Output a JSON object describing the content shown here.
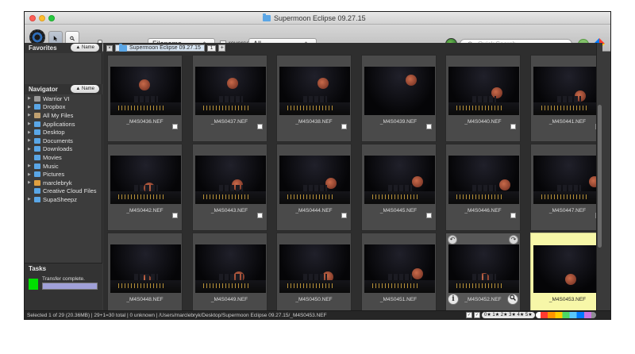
{
  "window": {
    "title": "Supermoon Eclipse 09.27.15"
  },
  "toolbar": {
    "sort_field": "Filename",
    "sort_arrows": "⌃⌄",
    "reverse_label": "reverse",
    "filter_value": "All",
    "search_placeholder": "Quick Search"
  },
  "sidebar": {
    "favorites_label": "Favorites",
    "favorites_sort": "▲ Name",
    "navigator_label": "Navigator",
    "navigator_sort": "▲ Name",
    "items": [
      {
        "label": "Warrior VI",
        "icon": "hard-drive-icon",
        "arrow": "▶"
      },
      {
        "label": "Dropbox",
        "icon": "folder-icon",
        "arrow": "▶"
      },
      {
        "label": "All My Files",
        "icon": "files-icon",
        "arrow": "▶"
      },
      {
        "label": "Applications",
        "icon": "folder-icon",
        "arrow": "▶"
      },
      {
        "label": "Desktop",
        "icon": "folder-icon",
        "arrow": "▶"
      },
      {
        "label": "Documents",
        "icon": "folder-icon",
        "arrow": "▶"
      },
      {
        "label": "Downloads",
        "icon": "folder-icon",
        "arrow": "▶"
      },
      {
        "label": "Movies",
        "icon": "folder-icon",
        "arrow": ""
      },
      {
        "label": "Music",
        "icon": "folder-icon",
        "arrow": "▶"
      },
      {
        "label": "Pictures",
        "icon": "folder-icon",
        "arrow": "▶"
      },
      {
        "label": "marclebryk",
        "icon": "home-icon",
        "arrow": "▶"
      },
      {
        "label": "Creative Cloud Files",
        "icon": "folder-icon",
        "arrow": ""
      },
      {
        "label": "SupaSheepz",
        "icon": "folder-icon",
        "arrow": "▶"
      }
    ],
    "tasks_label": "Tasks",
    "task_status": "Transfer complete."
  },
  "content": {
    "tab_label": "Supermoon Eclipse 09.27.15",
    "tab_count": "1",
    "thumbnails": [
      {
        "name": "_M4S0436.NEF"
      },
      {
        "name": "_M4S0437.NEF"
      },
      {
        "name": "_M4S0438.NEF"
      },
      {
        "name": "_M4S0439.NEF"
      },
      {
        "name": "_M4S0440.NEF"
      },
      {
        "name": "_M4S0441.NEF"
      },
      {
        "name": "_M4S0442.NEF"
      },
      {
        "name": "_M4S0443.NEF"
      },
      {
        "name": "_M4S0444.NEF"
      },
      {
        "name": "_M4S0445.NEF"
      },
      {
        "name": "_M4S0446.NEF"
      },
      {
        "name": "_M4S0447.NEF"
      },
      {
        "name": "_M4S0448.NEF"
      },
      {
        "name": "_M4S0449.NEF"
      },
      {
        "name": "_M4S0450.NEF"
      },
      {
        "name": "_M4S0451.NEF"
      },
      {
        "name": "_M4S0452.NEF"
      },
      {
        "name": "_M4S0453.NEF"
      }
    ]
  },
  "status": {
    "text": "Selected 1 of 29 (20.36MB) | 29+1=30 total | 0 unknown | /Users/marclebryk/Desktop/Supermoon Eclipse 09.27.15/_M4S0453.NEF",
    "stars": "0★ 1★ 2★ 3★ 4★ 5★"
  },
  "colors": {
    "selected_highlight": "#f7f7a8",
    "task_indicator": "#00e000"
  }
}
